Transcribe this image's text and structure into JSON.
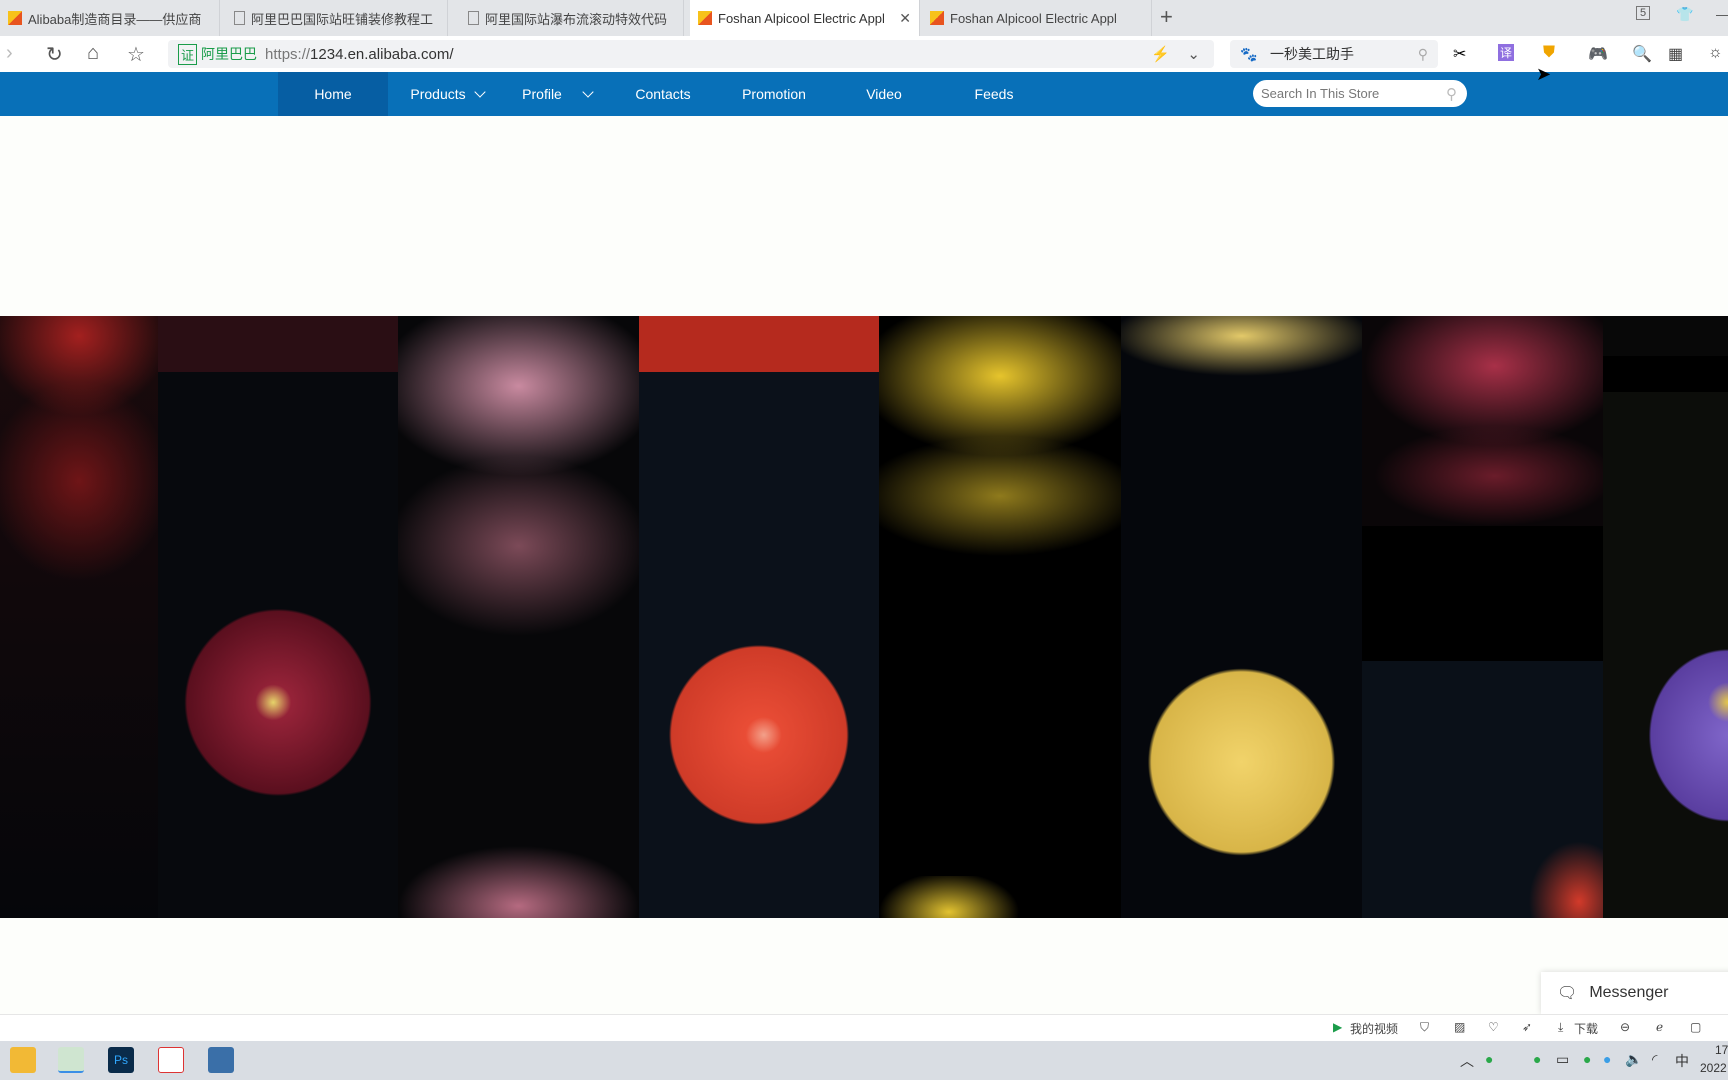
{
  "browser": {
    "tabs": [
      {
        "title": "Alibaba制造商目录——供应商",
        "icon": "alibaba-favicon",
        "active": false
      },
      {
        "title": "阿里巴巴国际站旺铺装修教程工",
        "icon": "document-icon",
        "active": false
      },
      {
        "title": "阿里国际站瀑布流滚动特效代码",
        "icon": "document-icon",
        "active": false
      },
      {
        "title": "Foshan Alpicool Electric Appl",
        "icon": "alibaba-favicon",
        "active": true
      },
      {
        "title": "Foshan Alpicool Electric Appl",
        "icon": "alibaba-favicon",
        "active": false
      }
    ],
    "tab_count": "5",
    "cert_label": "阿里巴巴",
    "url_scheme": "https://",
    "url_rest": "1234.en.alibaba.com/",
    "search_engine_text": "一秒美工助手"
  },
  "store": {
    "nav": [
      {
        "label": "Home",
        "active": true,
        "dropdown": false
      },
      {
        "label": "Products",
        "active": false,
        "dropdown": true
      },
      {
        "label": "Profile",
        "active": false,
        "dropdown": true
      },
      {
        "label": "Contacts",
        "active": false,
        "dropdown": false
      },
      {
        "label": "Promotion",
        "active": false,
        "dropdown": false
      },
      {
        "label": "Video",
        "active": false,
        "dropdown": false
      },
      {
        "label": "Feeds",
        "active": false,
        "dropdown": false
      }
    ],
    "search_placeholder": "Search In This Store",
    "accent": "#0870b8"
  },
  "gallery": {
    "flowers": [
      "red",
      "crimson",
      "pink",
      "orange-red",
      "yellow",
      "yellow-ball",
      "rose",
      "purple"
    ]
  },
  "messenger": {
    "label": "Messenger"
  },
  "statusbar": {
    "my_video": "我的视频",
    "download": "下载"
  },
  "taskbar": {
    "ime": "中",
    "clock_partial": "17",
    "date_partial": "2022"
  }
}
